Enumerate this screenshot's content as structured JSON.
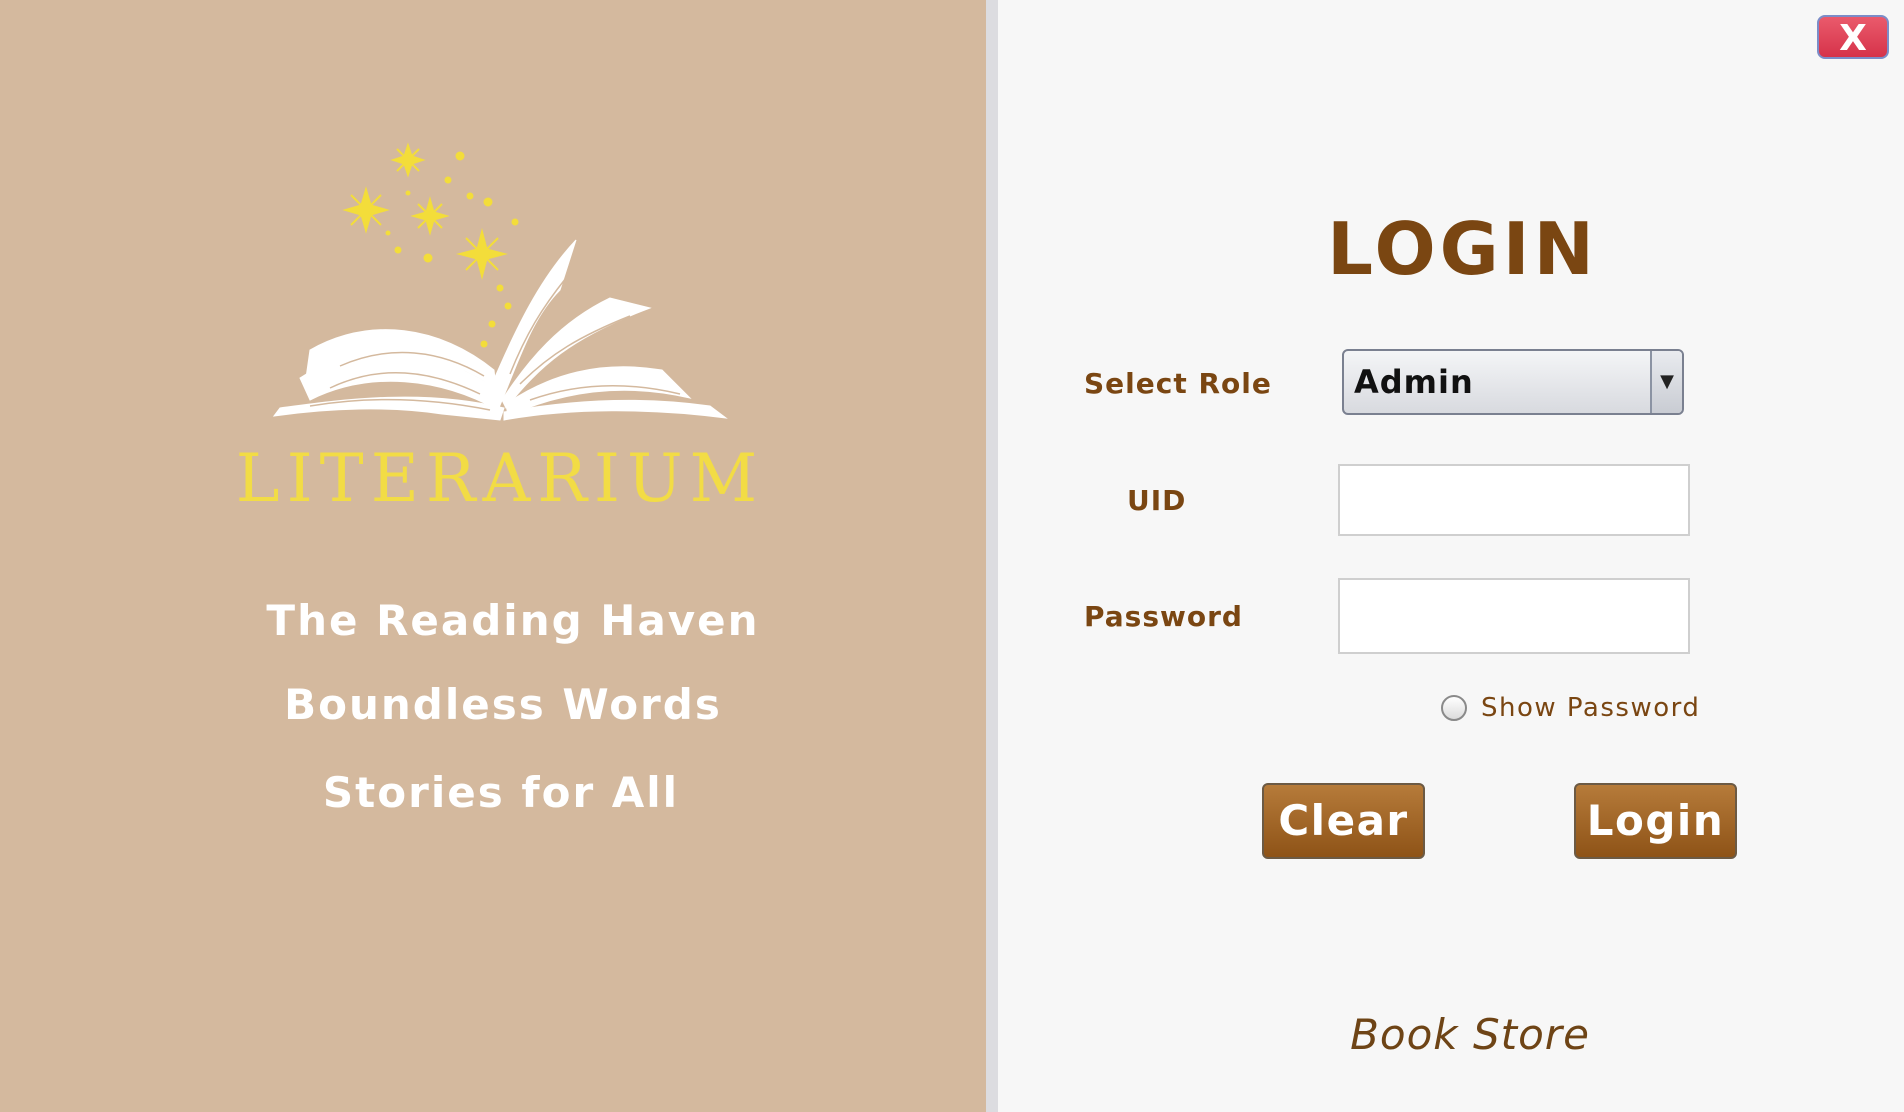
{
  "brand": {
    "name": "LITERARIUM",
    "taglines": [
      "The Reading Haven",
      "Boundless Words",
      "Stories for All"
    ],
    "logo_icon": "open-book-with-sparkles-icon"
  },
  "window": {
    "close_label": "X"
  },
  "login": {
    "title": "LOGIN",
    "role_label": "Select Role",
    "role_value": "Admin",
    "uid_label": "UID",
    "uid_value": "",
    "password_label": "Password",
    "password_value": "",
    "show_password_label": "Show Password",
    "show_password_checked": false,
    "clear_label": "Clear",
    "login_label": "Login"
  },
  "footer": {
    "store_label": "Book Store"
  },
  "colors": {
    "left_panel_bg": "#d4b99e",
    "accent_brown": "#7a4612",
    "button_brown": "#a3652a",
    "brand_gold": "#f2dc45",
    "close_red": "#e0404f"
  }
}
